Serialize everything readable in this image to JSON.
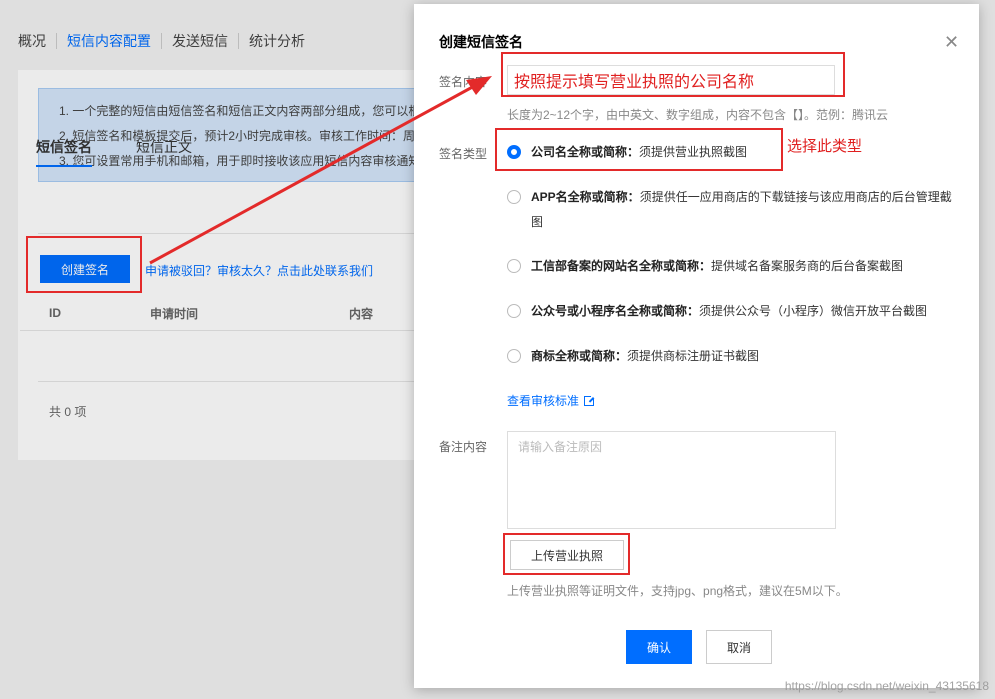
{
  "background": {
    "nav": [
      "概况",
      "短信内容配置",
      "发送短信",
      "统计分析"
    ],
    "nav_active": 1,
    "notice": [
      "1. 一个完整的短信由短信签名和短信正文内容两部分组成，您可以根",
      "2. 短信签名和模板提交后，预计2小时完成审核。审核工作时间：周",
      "3. 您可设置常用手机和邮箱，用于即时接收该应用短信内容审核通知"
    ],
    "subtabs": [
      "短信签名",
      "短信正文"
    ],
    "create_button": "创建签名",
    "appeal_link": "申请被驳回？审核太久？点击此处联系我们",
    "table_columns": [
      "ID",
      "申请时间",
      "内容"
    ],
    "total": "共 0 项"
  },
  "modal": {
    "title": "创建短信签名",
    "close_icon": "close-icon",
    "signature_label": "签名内容",
    "signature_value": "按照提示填写营业执照的公司名称",
    "signature_hint": "长度为2~12个字，由中英文、数字组成，内容不包含【】。范例：腾讯云",
    "type_label": "签名类型",
    "types": [
      {
        "name": "公司名全称或简称：",
        "desc": "须提供营业执照截图",
        "checked": true
      },
      {
        "name": "APP名全称或简称：",
        "desc": "须提供任一应用商店的下载链接与该应用商店的后台管理截图",
        "checked": false
      },
      {
        "name": "工信部备案的网站名全称或简称：",
        "desc": "提供域名备案服务商的后台备案截图",
        "checked": false
      },
      {
        "name": "公众号或小程序名全称或简称：",
        "desc": "须提供公众号（小程序）微信开放平台截图",
        "checked": false
      },
      {
        "name": "商标全称或简称：",
        "desc": "须提供商标注册证书截图",
        "checked": false
      }
    ],
    "audit_link": "查看审核标准",
    "remark_label": "备注内容",
    "remark_placeholder": "请输入备注原因",
    "upload_button": "上传营业执照",
    "upload_hint": "上传营业执照等证明文件，支持jpg、png格式，建议在5M以下。",
    "confirm_button": "确认",
    "cancel_button": "取消"
  },
  "annotations": {
    "choose_type": "选择此类型",
    "color": "#e32a2a"
  },
  "watermark": "https://blog.csdn.net/weixin_43135618",
  "colors": {
    "accent": "#006eff",
    "annotation": "#e32a2a"
  }
}
